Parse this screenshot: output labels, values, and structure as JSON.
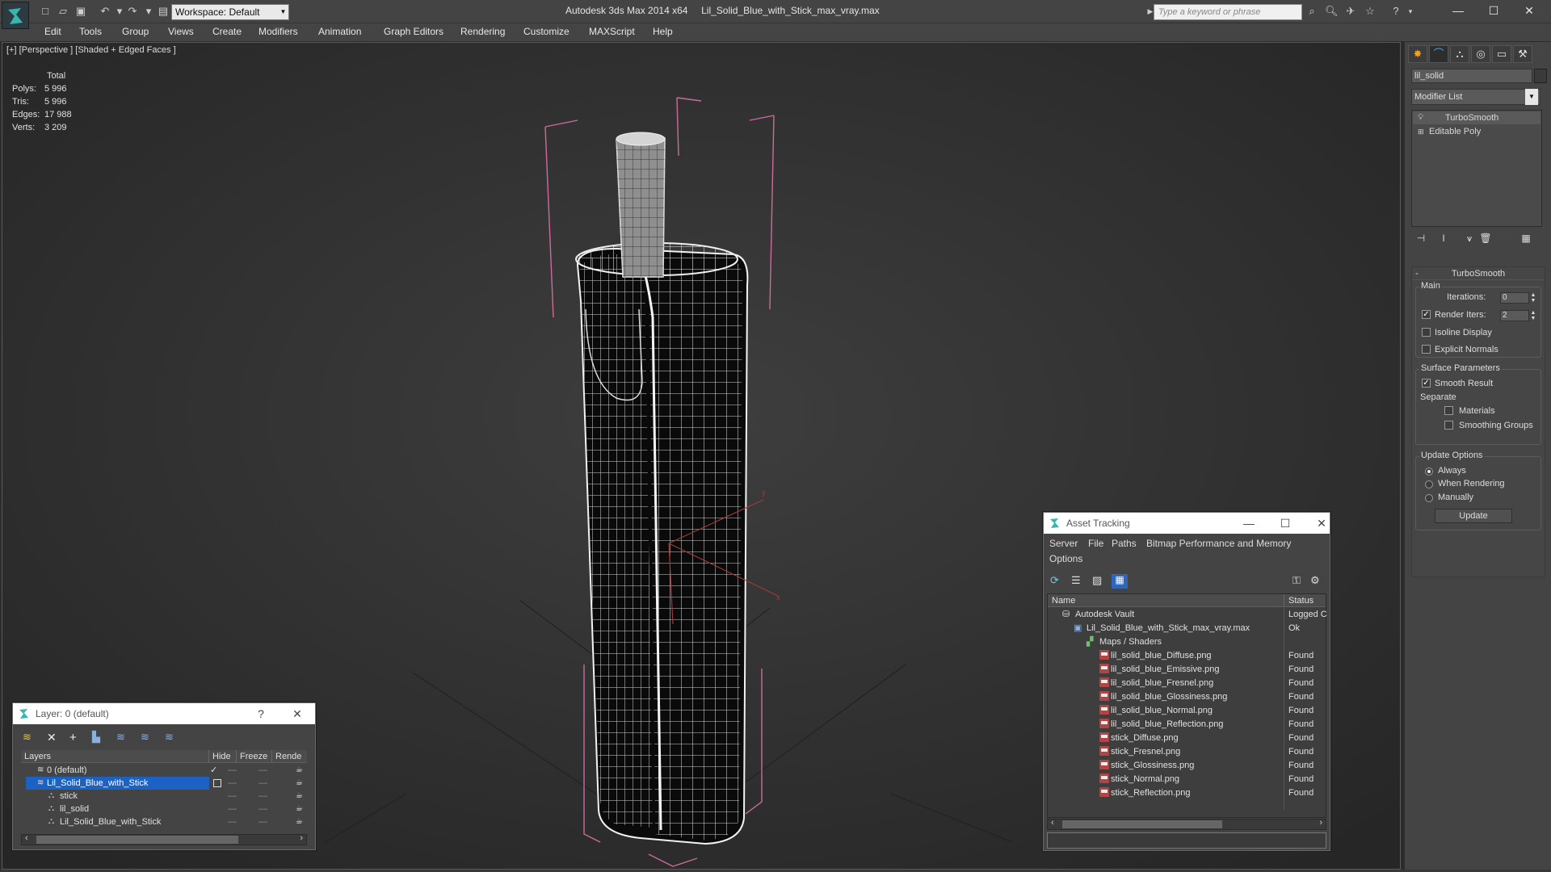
{
  "titlebar": {
    "workspace": "Workspace: Default",
    "app": "Autodesk 3ds Max  2014 x64",
    "file": "Lil_Solid_Blue_with_Stick_max_vray.max",
    "search_placeholder": "Type a keyword or phrase"
  },
  "menu": [
    "Edit",
    "Tools",
    "Group",
    "Views",
    "Create",
    "Modifiers",
    "Animation",
    "Graph Editors",
    "Rendering",
    "Customize",
    "MAXScript",
    "Help"
  ],
  "viewport": {
    "label": "[+] [Perspective ] [Shaded + Edged Faces ]",
    "stats": {
      "header": "Total",
      "rows": [
        {
          "k": "Polys:",
          "v": "5 996"
        },
        {
          "k": "Tris:",
          "v": "5 996"
        },
        {
          "k": "Edges:",
          "v": "17 988"
        },
        {
          "k": "Verts:",
          "v": "3 209"
        }
      ]
    }
  },
  "command_panel": {
    "object_name": "lil_solid",
    "modifier_list": "Modifier List",
    "stack": [
      "TurboSmooth",
      "Editable Poly"
    ],
    "turbosmooth": {
      "title": "TurboSmooth",
      "main": "Main",
      "iterations_label": "Iterations:",
      "iterations": "0",
      "render_iters_label": "Render Iters:",
      "render_iters": "2",
      "isoline": "Isoline Display",
      "explicit": "Explicit Normals",
      "surface": "Surface Parameters",
      "smooth": "Smooth Result",
      "separate": "Separate",
      "materials": "Materials",
      "smoothing_groups": "Smoothing Groups",
      "update_options": "Update Options",
      "always": "Always",
      "when_rendering": "When Rendering",
      "manually": "Manually",
      "update_btn": "Update"
    }
  },
  "layer_window": {
    "title": "Layer: 0 (default)",
    "cols": [
      "Layers",
      "Hide",
      "Freeze",
      "Rende"
    ],
    "rows": [
      "0 (default)",
      "Lil_Solid_Blue_with_Stick",
      "stick",
      "lil_solid",
      "Lil_Solid_Blue_with_Stick"
    ]
  },
  "asset_window": {
    "title": "Asset Tracking",
    "menu": [
      "Server",
      "File",
      "Paths",
      "Bitmap Performance and Memory",
      "Options"
    ],
    "cols": [
      "Name",
      "Status"
    ],
    "rows": [
      {
        "name": "Autodesk Vault",
        "status": "Logged C"
      },
      {
        "name": "Lil_Solid_Blue_with_Stick_max_vray.max",
        "status": "Ok"
      },
      {
        "name": "Maps / Shaders",
        "status": ""
      },
      {
        "name": "lil_solid_blue_Diffuse.png",
        "status": "Found"
      },
      {
        "name": "lil_solid_blue_Emissive.png",
        "status": "Found"
      },
      {
        "name": "lil_solid_blue_Fresnel.png",
        "status": "Found"
      },
      {
        "name": "lil_solid_blue_Glossiness.png",
        "status": "Found"
      },
      {
        "name": "lil_solid_blue_Normal.png",
        "status": "Found"
      },
      {
        "name": "lil_solid_blue_Reflection.png",
        "status": "Found"
      },
      {
        "name": "stick_Diffuse.png",
        "status": "Found"
      },
      {
        "name": "stick_Fresnel.png",
        "status": "Found"
      },
      {
        "name": "stick_Glossiness.png",
        "status": "Found"
      },
      {
        "name": "stick_Normal.png",
        "status": "Found"
      },
      {
        "name": "stick_Reflection.png",
        "status": "Found"
      }
    ]
  },
  "colors": {
    "selection": "#1c62c4",
    "stats_text": "#f0e6a0",
    "bbox": "#d06a9a"
  }
}
